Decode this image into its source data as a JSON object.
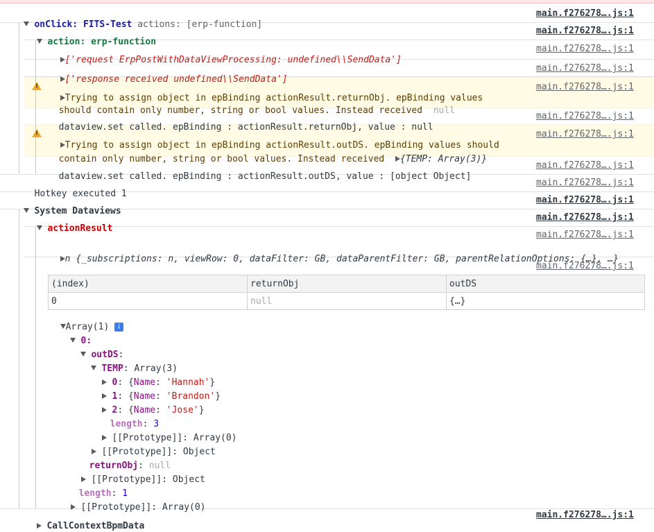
{
  "source": {
    "short": "main.f276278….js:1"
  },
  "onclick": {
    "label": "onClick:",
    "name": "FITS-Test",
    "actions": "actions: [erp-function]"
  },
  "action": {
    "label": "action:",
    "name": "erp-function"
  },
  "logs": {
    "request": "['request ErpPostWithDataViewProcessing: undefined\\\\SendData']",
    "response": "['response received undefined\\\\SendData']",
    "warn1_line1": "Trying to assign object in epBinding actionResult.returnObj. epBinding values",
    "warn1_line2": "should contain only number, string or bool values. Instead received",
    "warn1_value": "null",
    "set1": "dataview.set called. epBinding : actionResult.returnObj, value : null",
    "warn2_line1": "Trying to assign object in epBinding actionResult.outDS. epBinding values should",
    "warn2_line2": "contain only number, string or bool values. Instead received",
    "warn2_value": "{TEMP: Array(3)}",
    "set2": "dataview.set called. epBinding : actionResult.outDS, value : [object Object]",
    "hotkey": "Hotkey executed 1",
    "system": "System Dataviews",
    "actionresult": "actionResult",
    "nobj": "n {_subscriptions: n, viewRow: 0, dataFilter: GB, dataParentFilter: GB, parentRelationOptions: {…}, …}",
    "callcontext": "CallContextBpmData"
  },
  "table": {
    "headers": [
      "(index)",
      "returnObj",
      "outDS"
    ],
    "rows": [
      [
        "0",
        "null",
        "{…}"
      ]
    ]
  },
  "tree": {
    "array_label": "Array(1)",
    "info": "i",
    "idx0": "0",
    "outds": "outDS",
    "temp_key": "TEMP",
    "temp_val": "Array(3)",
    "items": [
      {
        "idx": "0",
        "name": "'Hannah'"
      },
      {
        "idx": "1",
        "name": "'Brandon'"
      },
      {
        "idx": "2",
        "name": "'Jose'"
      }
    ],
    "name_key": "Name",
    "length_key": "length",
    "length3": "3",
    "proto_key": "[[Prototype]]",
    "proto_array0": "Array(0)",
    "proto_object": "Object",
    "returnobj_key": "returnObj",
    "returnobj_val": "null",
    "length1": "1"
  }
}
